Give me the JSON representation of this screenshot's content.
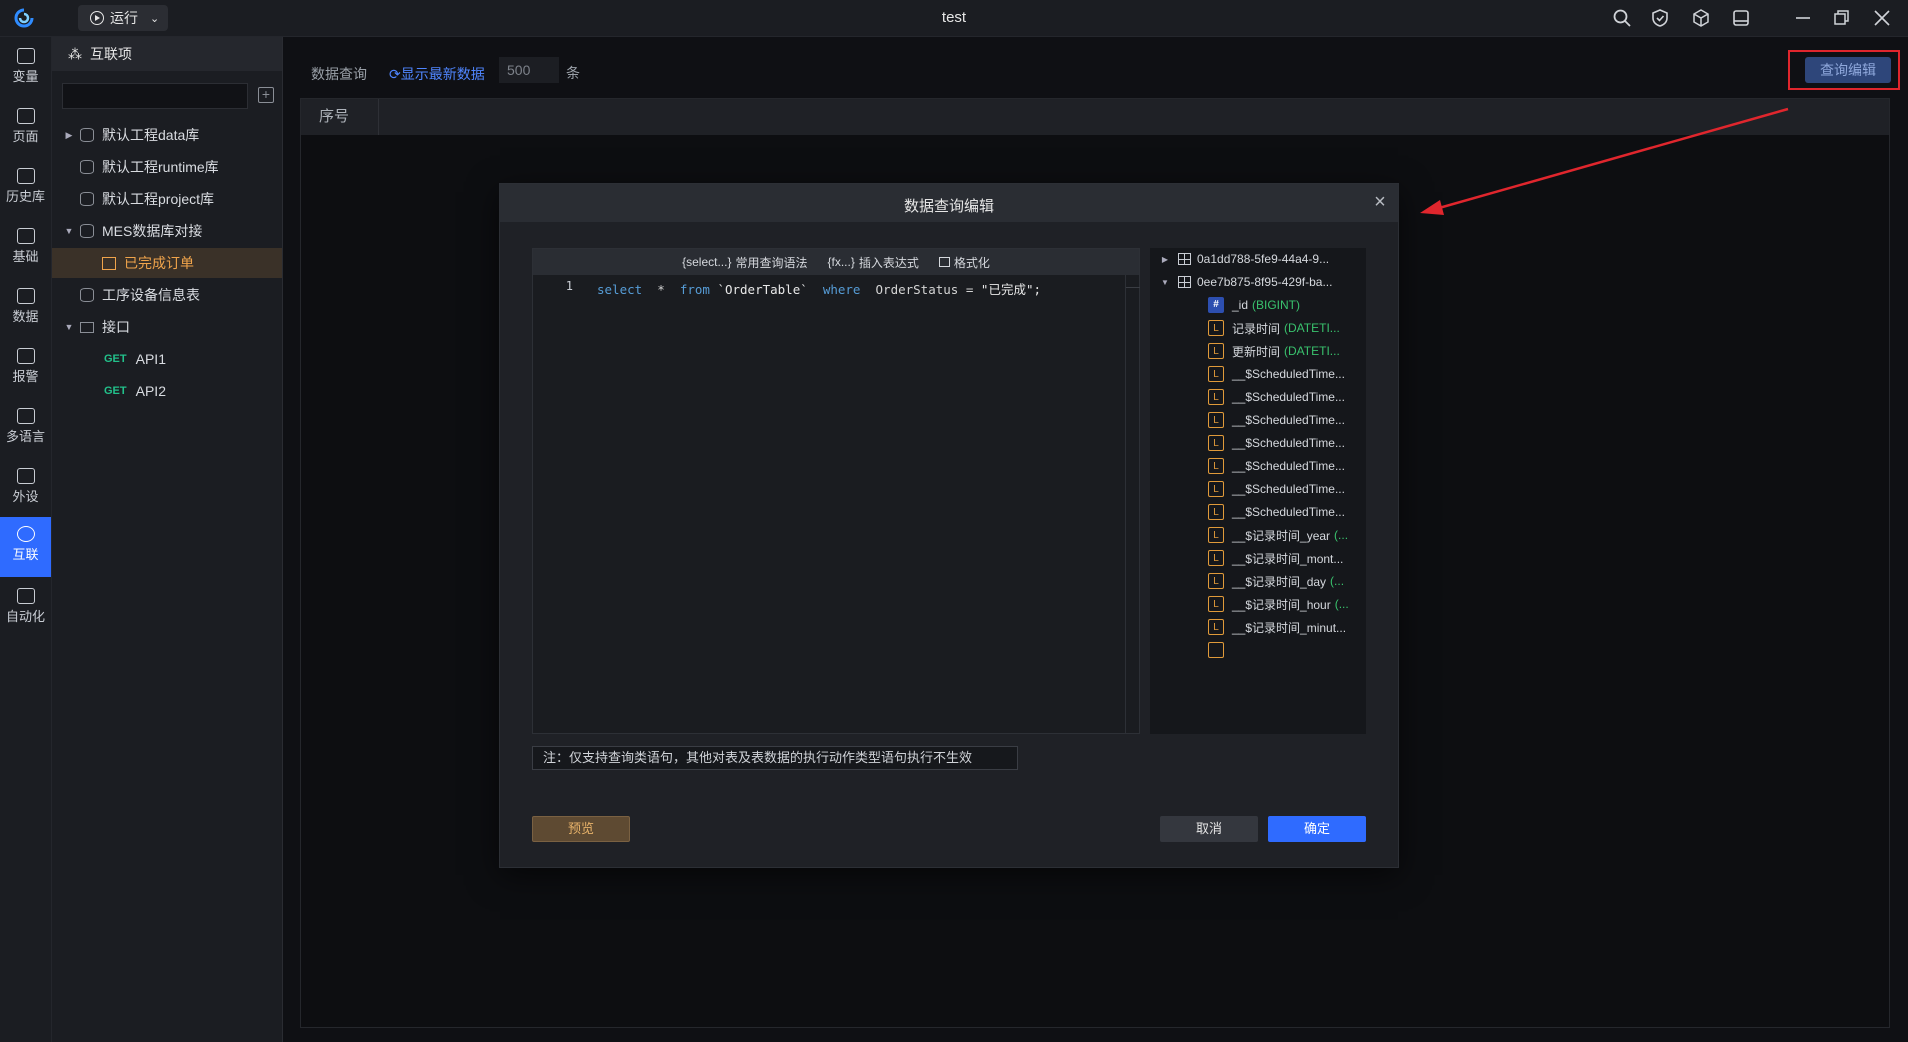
{
  "titlebar": {
    "run_label": "运行",
    "window_title": "test",
    "icons": [
      "search-icon",
      "shield-icon",
      "cube-icon",
      "layout-icon",
      "minimize-icon",
      "restore-icon",
      "close-icon"
    ]
  },
  "rail": {
    "items": [
      {
        "label": "变量",
        "icon": "variable-icon"
      },
      {
        "label": "页面",
        "icon": "page-icon"
      },
      {
        "label": "历史库",
        "icon": "history-db-icon"
      },
      {
        "label": "基础",
        "icon": "base-icon"
      },
      {
        "label": "数据",
        "icon": "data-icon"
      },
      {
        "label": "报警",
        "icon": "alarm-icon"
      },
      {
        "label": "多语言",
        "icon": "language-icon"
      },
      {
        "label": "外设",
        "icon": "peripheral-icon"
      },
      {
        "label": "互联",
        "icon": "interconnect-icon",
        "active": true
      },
      {
        "label": "自动化",
        "icon": "automation-icon"
      }
    ]
  },
  "tree": {
    "header": "互联项",
    "search_value": "",
    "nodes": [
      {
        "label": "默认工程data库"
      },
      {
        "label": "默认工程runtime库"
      },
      {
        "label": "默认工程project库"
      },
      {
        "label": "MES数据库对接"
      },
      {
        "label": "已完成订单"
      },
      {
        "label": "工序设备信息表"
      },
      {
        "label": "接口"
      },
      {
        "label": "API1",
        "method": "GET"
      },
      {
        "label": "API2",
        "method": "GET"
      }
    ]
  },
  "main": {
    "toolbar_label": "数据查询",
    "refresh_label": "显示最新数据",
    "limit_value": "500",
    "limit_unit": "条",
    "query_edit_label": "查询编辑",
    "columns": [
      "序号"
    ]
  },
  "dialog": {
    "title": "数据查询编辑",
    "toolbar": {
      "select_tag": "{select...}",
      "select_label": "常用查询语法",
      "fx_tag": "{fx...}",
      "fx_label": "插入表达式",
      "format_label": "格式化"
    },
    "editor": {
      "line_number": "1",
      "code": {
        "select": "select",
        "star": "*",
        "from": "from",
        "table": "`OrderTable`",
        "where": "where",
        "field": "OrderStatus",
        "eq": "=",
        "value": "\"已完成\";"
      }
    },
    "note": "注：仅支持查询类语句，其他对表及表数据的执行动作类型语句执行不生效",
    "schema": [
      {
        "kind": "table",
        "caret": "right",
        "name": "0a1dd788-5fe9-44a4-9..."
      },
      {
        "kind": "table",
        "caret": "down",
        "name": "0ee7b875-8f95-429f-ba..."
      },
      {
        "kind": "field",
        "icon": "#",
        "name": "_id",
        "type": "(BIGINT)"
      },
      {
        "kind": "field",
        "icon": "L",
        "name": "记录时间",
        "type": "(DATETI..."
      },
      {
        "kind": "field",
        "icon": "L",
        "name": "更新时间",
        "type": "(DATETI..."
      },
      {
        "kind": "field",
        "icon": "L",
        "name": "__$ScheduledTime...",
        "type": ""
      },
      {
        "kind": "field",
        "icon": "L",
        "name": "__$ScheduledTime...",
        "type": ""
      },
      {
        "kind": "field",
        "icon": "L",
        "name": "__$ScheduledTime...",
        "type": ""
      },
      {
        "kind": "field",
        "icon": "L",
        "name": "__$ScheduledTime...",
        "type": ""
      },
      {
        "kind": "field",
        "icon": "L",
        "name": "__$ScheduledTime...",
        "type": ""
      },
      {
        "kind": "field",
        "icon": "L",
        "name": "__$ScheduledTime...",
        "type": ""
      },
      {
        "kind": "field",
        "icon": "L",
        "name": "__$ScheduledTime...",
        "type": ""
      },
      {
        "kind": "field",
        "icon": "L",
        "name": "__$记录时间_year",
        "type": "(..."
      },
      {
        "kind": "field",
        "icon": "L",
        "name": "__$记录时间_mont...",
        "type": ""
      },
      {
        "kind": "field",
        "icon": "L",
        "name": "__$记录时间_day",
        "type": "(..."
      },
      {
        "kind": "field",
        "icon": "L",
        "name": "__$记录时间_hour",
        "type": "(..."
      },
      {
        "kind": "field",
        "icon": "L",
        "name": "__$记录时间_minut...",
        "type": ""
      }
    ],
    "preview_label": "预览",
    "cancel_label": "取消",
    "ok_label": "确定"
  },
  "colors": {
    "accent": "#2f6bff",
    "annotation": "#e0262d",
    "selected_text": "#f0a44b",
    "sql_keyword": "#569cd6",
    "type_text": "#39c26d"
  }
}
